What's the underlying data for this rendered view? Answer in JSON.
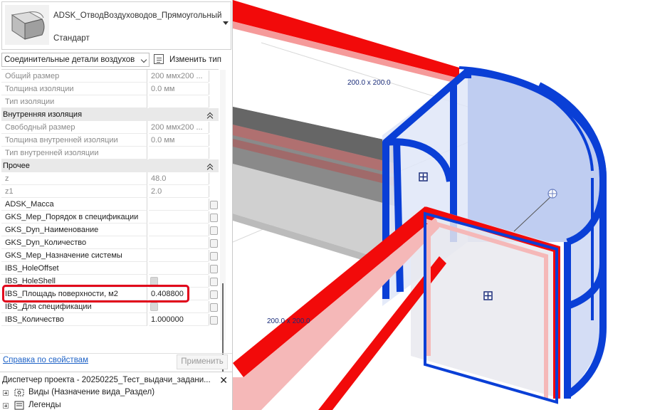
{
  "type_selector": {
    "family": "ADSK_ОтводВоздуховодов_Прямоугольный",
    "type": "Стандарт"
  },
  "category_filter": {
    "value": "Соединительные детали воздухов",
    "edit_type_label": "Изменить тип"
  },
  "properties": [
    {
      "kind": "param",
      "name": "Общий размер",
      "value": "200 ммх200 ...",
      "readonly": true
    },
    {
      "kind": "param",
      "name": "Толщина изоляции",
      "value": "0.0 мм",
      "readonly": true
    },
    {
      "kind": "param",
      "name": "Тип изоляции",
      "value": "",
      "readonly": true
    },
    {
      "kind": "group",
      "name": "Внутренняя изоляция"
    },
    {
      "kind": "param",
      "name": "Свободный размер",
      "value": "200 ммх200 ...",
      "readonly": true
    },
    {
      "kind": "param",
      "name": "Толщина внутренней изоляции",
      "value": "0.0 мм",
      "readonly": true
    },
    {
      "kind": "param",
      "name": "Тип внутренней изоляции",
      "value": "",
      "readonly": true
    },
    {
      "kind": "group",
      "name": "Прочее"
    },
    {
      "kind": "param",
      "name": "z",
      "value": "48.0",
      "readonly": true
    },
    {
      "kind": "param",
      "name": "z1",
      "value": "2.0",
      "readonly": true
    },
    {
      "kind": "param",
      "name": "ADSK_Масса",
      "value": "",
      "readonly": false
    },
    {
      "kind": "param",
      "name": "GKS_Мер_Порядок в спецификации",
      "value": "",
      "readonly": false
    },
    {
      "kind": "param",
      "name": "GKS_Dyn_Наименование",
      "value": "",
      "readonly": false
    },
    {
      "kind": "param",
      "name": "GKS_Dyn_Количество",
      "value": "",
      "readonly": false
    },
    {
      "kind": "param",
      "name": "GKS_Мер_Назначение системы",
      "value": "",
      "readonly": false
    },
    {
      "kind": "param",
      "name": "IBS_HoleOffset",
      "value": "",
      "readonly": false
    },
    {
      "kind": "param",
      "name": "IBS_HoleShell",
      "value": "",
      "readonly": false,
      "checkbox": "disabled"
    },
    {
      "kind": "param",
      "name": "IBS_Площадь поверхности, м2",
      "value": "0.408800",
      "readonly": false,
      "highlighted": true
    },
    {
      "kind": "param",
      "name": "IBS_Для спецификации",
      "value": "",
      "readonly": false,
      "checkbox": "disabled"
    },
    {
      "kind": "param",
      "name": "IBS_Количество",
      "value": "1.000000",
      "readonly": false
    }
  ],
  "footer": {
    "help_link": "Справка по свойствам",
    "apply_button": "Применить"
  },
  "project_browser": {
    "title": "Диспетчер проекта - 20250225_Тест_выдачи_задани...",
    "close": "✕",
    "items": [
      {
        "label": "Виды (Назначение вида_Раздел)",
        "icon": "views-icon"
      },
      {
        "label": "Легенды",
        "icon": "legends-icon"
      }
    ]
  },
  "viewport": {
    "dimension_labels": [
      "200.0 x 200.0",
      "200.0 x 200.0"
    ]
  },
  "colors": {
    "duct_red": "#f20a0a",
    "fitting_blue": "#0a3fd6",
    "highlight_red": "#e1001a",
    "link_blue": "#1f63c7"
  }
}
